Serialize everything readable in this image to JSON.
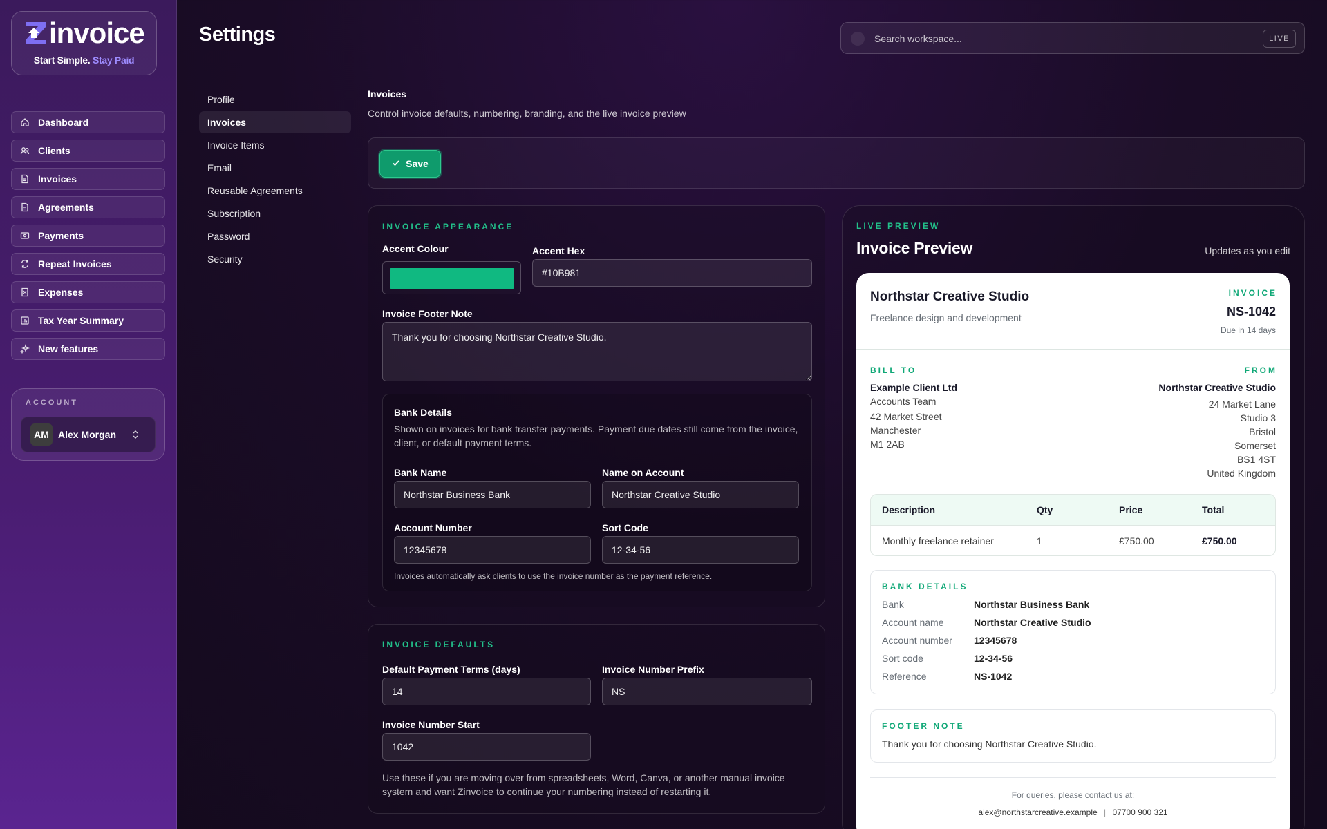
{
  "brand": {
    "name": "invoice",
    "tagline_a": "Start Simple.",
    "tagline_b": "Stay Paid",
    "dash": "—",
    "accent": "#9e8cff"
  },
  "sidebar": {
    "items": [
      {
        "label": "Dashboard",
        "icon": "home-icon"
      },
      {
        "label": "Clients",
        "icon": "users-icon"
      },
      {
        "label": "Invoices",
        "icon": "document-icon"
      },
      {
        "label": "Agreements",
        "icon": "document-icon"
      },
      {
        "label": "Payments",
        "icon": "payment-icon"
      },
      {
        "label": "Repeat Invoices",
        "icon": "repeat-icon"
      },
      {
        "label": "Expenses",
        "icon": "receipt-icon"
      },
      {
        "label": "Tax Year Summary",
        "icon": "chart-icon"
      },
      {
        "label": "New features",
        "icon": "sparkle-icon"
      }
    ],
    "account_label": "ACCOUNT",
    "user_initials": "AM",
    "user_name": "Alex Morgan"
  },
  "header": {
    "title": "Settings",
    "search_placeholder": "Search workspace...",
    "live_badge": "LIVE"
  },
  "settings_nav": {
    "items": [
      "Profile",
      "Invoices",
      "Invoice Items",
      "Email",
      "Reusable Agreements",
      "Subscription",
      "Password",
      "Security"
    ],
    "active": "Invoices"
  },
  "section": {
    "title": "Invoices",
    "description": "Control invoice defaults, numbering, branding, and the live invoice preview",
    "save_label": "Save"
  },
  "appearance": {
    "heading": "INVOICE APPEARANCE",
    "accent_colour_label": "Accent Colour",
    "accent_hex_label": "Accent Hex",
    "accent_hex_value": "#10B981",
    "accent_color": "#10b981",
    "footer_note_label": "Invoice Footer Note",
    "footer_note_value": "Thank you for choosing Northstar Creative Studio.",
    "bank": {
      "title": "Bank Details",
      "description": "Shown on invoices for bank transfer payments. Payment due dates still come from the invoice, client, or default payment terms.",
      "bank_name_label": "Bank Name",
      "bank_name_value": "Northstar Business Bank",
      "account_name_label": "Name on Account",
      "account_name_value": "Northstar Creative Studio",
      "account_number_label": "Account Number",
      "account_number_value": "12345678",
      "sort_code_label": "Sort Code",
      "sort_code_value": "12-34-56",
      "note": "Invoices automatically ask clients to use the invoice number as the payment reference."
    }
  },
  "defaults": {
    "heading": "INVOICE DEFAULTS",
    "terms_label": "Default Payment Terms (days)",
    "terms_value": "14",
    "prefix_label": "Invoice Number Prefix",
    "prefix_value": "NS",
    "start_label": "Invoice Number Start",
    "start_value": "1042",
    "help": "Use these if you are moving over from spreadsheets, Word, Canva, or another manual invoice system and want Zinvoice to continue your numbering instead of restarting it."
  },
  "preview": {
    "heading": "LIVE PREVIEW",
    "title": "Invoice Preview",
    "updates_note": "Updates as you edit",
    "company": "Northstar Creative Studio",
    "company_sub": "Freelance design and development",
    "invoice_word": "INVOICE",
    "invoice_number": "NS-1042",
    "due": "Due in 14 days",
    "bill_to_label": "BILL TO",
    "bill_to": [
      "Example Client Ltd",
      "Accounts Team",
      "42 Market Street",
      "Manchester",
      "M1 2AB"
    ],
    "from_label": "FROM",
    "from": [
      "Northstar Creative Studio",
      "24 Market Lane",
      "Studio 3",
      "Bristol",
      "Somerset",
      "BS1 4ST",
      "United Kingdom"
    ],
    "table": {
      "headers": [
        "Description",
        "Qty",
        "Price",
        "Total"
      ],
      "rows": [
        [
          "Monthly freelance retainer",
          "1",
          "£750.00",
          "£750.00"
        ]
      ]
    },
    "bank_label": "BANK DETAILS",
    "bank_rows": [
      [
        "Bank",
        "Northstar Business Bank"
      ],
      [
        "Account name",
        "Northstar Creative Studio"
      ],
      [
        "Account number",
        "12345678"
      ],
      [
        "Sort code",
        "12-34-56"
      ],
      [
        "Reference",
        "NS-1042"
      ]
    ],
    "footer_label": "FOOTER NOTE",
    "footer_note": "Thank you for choosing Northstar Creative Studio.",
    "contact_intro": "For queries, please contact us at:",
    "contact_email": "alex@northstarcreative.example",
    "contact_sep": "|",
    "contact_phone": "07700 900 321"
  }
}
